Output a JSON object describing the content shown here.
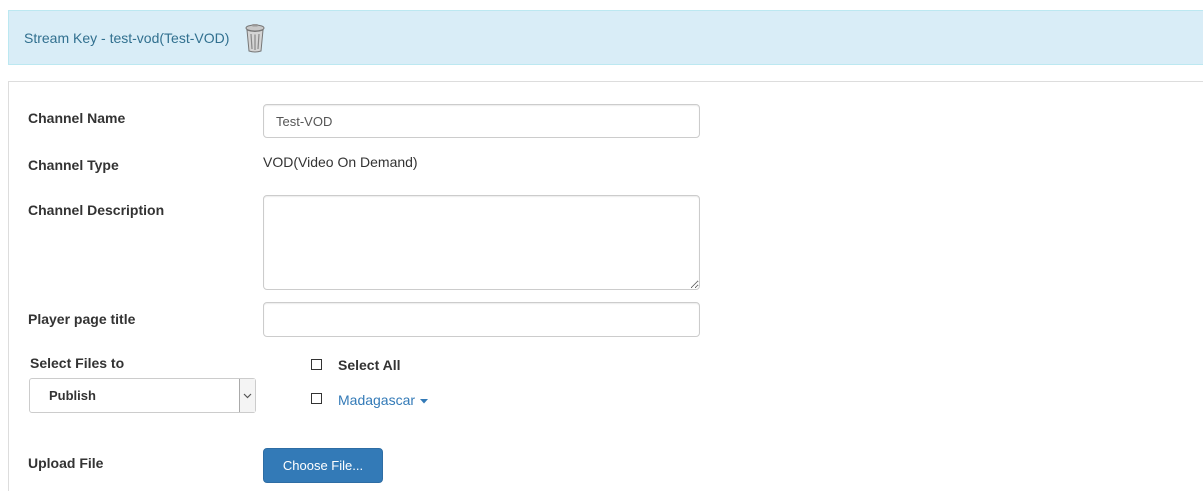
{
  "header": {
    "title": "Stream Key - test-vod(Test-VOD)",
    "delete_icon": "trash-can-icon"
  },
  "form": {
    "channel_name": {
      "label": "Channel Name",
      "value": "Test-VOD"
    },
    "channel_type": {
      "label": "Channel Type",
      "value": "VOD(Video On Demand)"
    },
    "channel_description": {
      "label": "Channel Description",
      "value": ""
    },
    "player_page_title": {
      "label": "Player page title",
      "value": ""
    },
    "select_files": {
      "label": "Select Files to",
      "selected_option": "Publish",
      "select_all_label": "Select All",
      "files": [
        {
          "name": "Madagascar",
          "checked": false
        }
      ]
    },
    "upload_file": {
      "label": "Upload File",
      "button_label": "Choose File..."
    }
  },
  "colors": {
    "header_bg": "#d9edf7",
    "header_text": "#31708f",
    "link": "#337ab7",
    "primary_button": "#337ab7"
  }
}
